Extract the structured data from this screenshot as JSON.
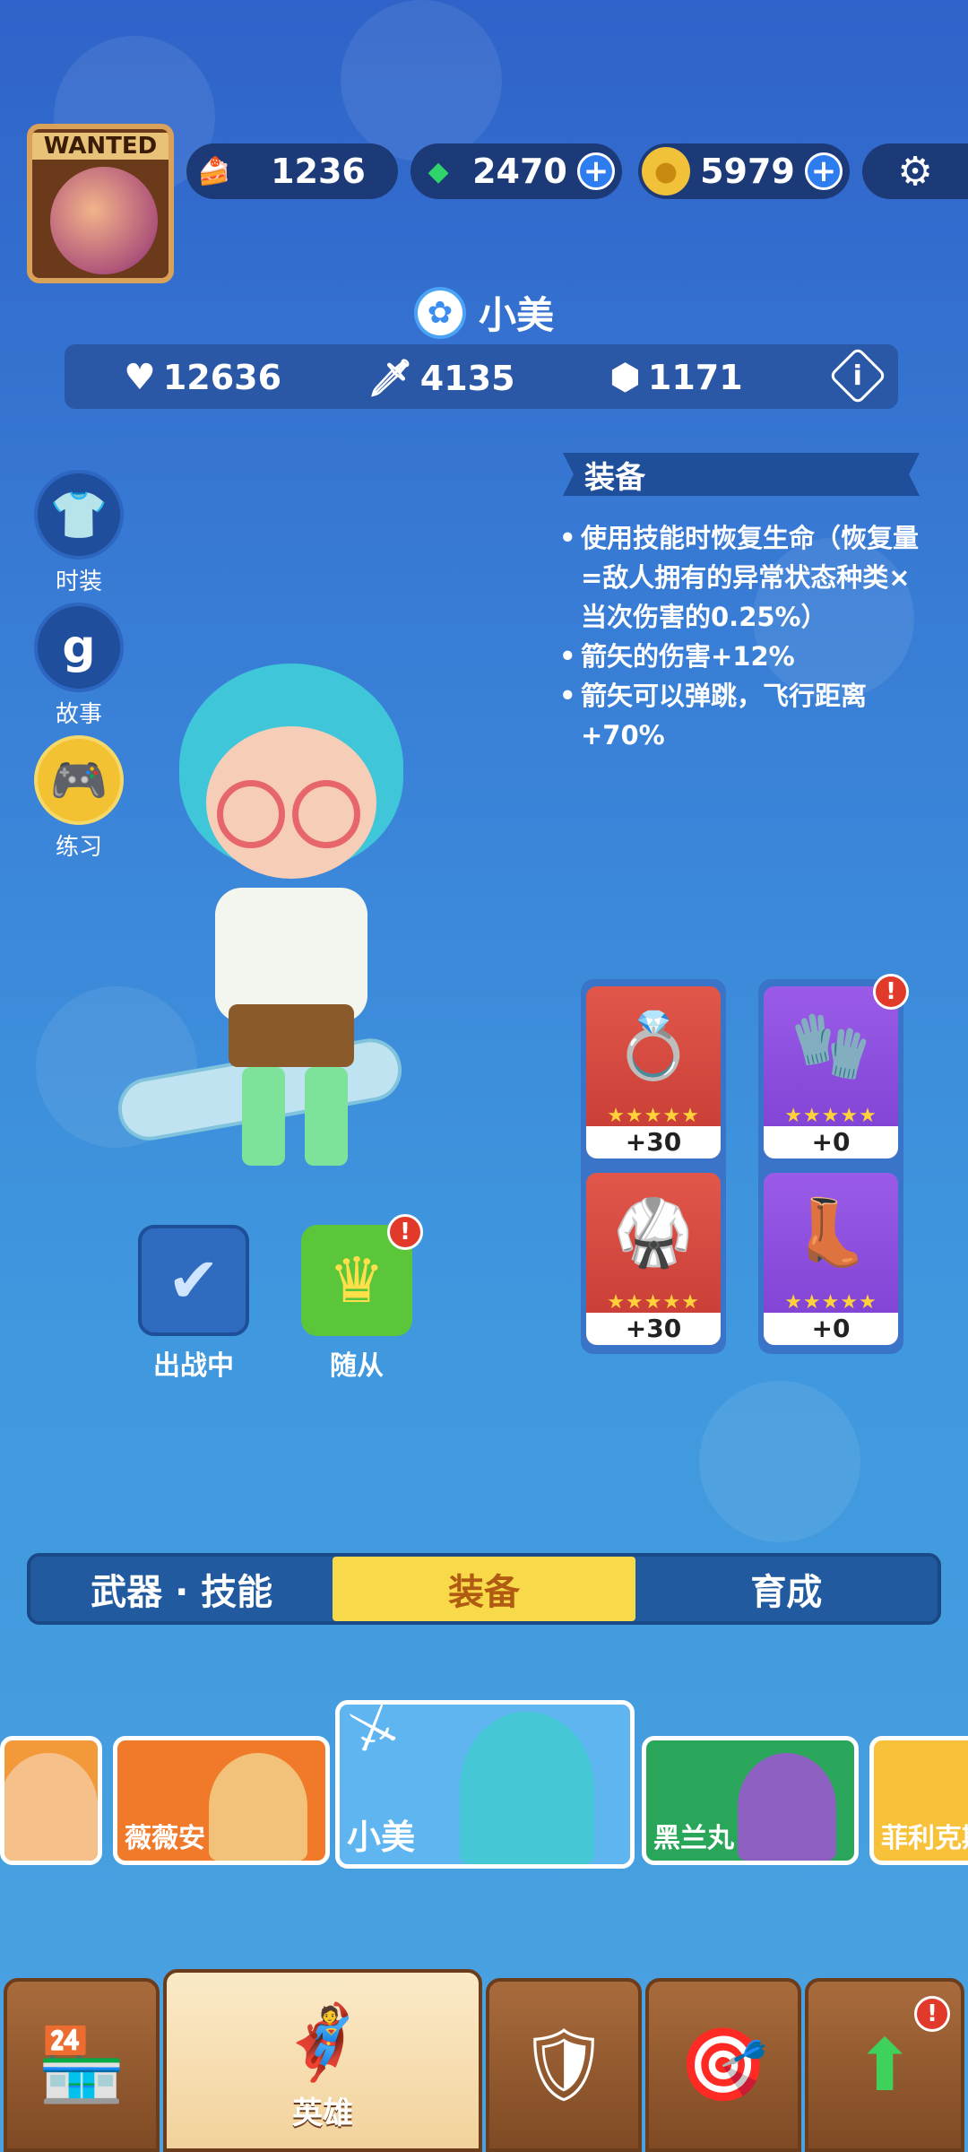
{
  "player": {
    "banner_text": "WANTED"
  },
  "resources": [
    {
      "name": "cake",
      "icon": "cake-icon",
      "value": "1236",
      "has_plus": false
    },
    {
      "name": "gem",
      "icon": "gem-icon",
      "value": "2470",
      "has_plus": true
    },
    {
      "name": "coin",
      "icon": "coin-icon",
      "value": "5979",
      "has_plus": true
    }
  ],
  "hero": {
    "name": "小美",
    "stats": {
      "hp": "12636",
      "attack": "4135",
      "defense": "1171"
    }
  },
  "side_buttons": [
    {
      "id": "outfit",
      "label": "时装",
      "icon": "shirt-icon"
    },
    {
      "id": "story",
      "label": "故事",
      "icon": "story-icon"
    },
    {
      "id": "practice",
      "label": "练习",
      "icon": "gamepad-icon"
    }
  ],
  "equipment": {
    "title": "装备",
    "effects": [
      "使用技能时恢复生命（恢复量=敌人拥有的异常状态种类×当次伤害的0.25%）",
      "箭矢的伤害+12%",
      "箭矢可以弹跳，飞行距离+70%"
    ],
    "slots": [
      {
        "id": "ring",
        "rarity": "red",
        "icon": "winged-ring-icon",
        "stars": 5,
        "level": "+30",
        "alert": false
      },
      {
        "id": "gloves",
        "rarity": "purple",
        "icon": "gloves-icon",
        "stars": 5,
        "level": "+0",
        "alert": true
      },
      {
        "id": "armor",
        "rarity": "red",
        "icon": "armor-icon",
        "stars": 5,
        "level": "+30",
        "alert": false
      },
      {
        "id": "boots",
        "rarity": "purple",
        "icon": "boots-icon",
        "stars": 5,
        "level": "+0",
        "alert": false
      }
    ]
  },
  "actions": {
    "deployed_label": "出战中",
    "follower_label": "随从"
  },
  "tabs": [
    {
      "label": "武器 · 技能",
      "active": false
    },
    {
      "label": "装备",
      "active": true
    },
    {
      "label": "育成",
      "active": false
    }
  ],
  "hero_cards": [
    {
      "name": "",
      "color": "#f29a3a"
    },
    {
      "name": "薇薇安",
      "color": "#f07a2a"
    },
    {
      "name": "小美",
      "color": "#5fb5f0",
      "selected": true
    },
    {
      "name": "黑兰丸",
      "color": "#2aa65a"
    },
    {
      "name": "菲利克斯",
      "color": "#f7c23a"
    }
  ],
  "nav": [
    {
      "id": "shop",
      "label": "",
      "icon": "shop-icon"
    },
    {
      "id": "heroes",
      "label": "英雄",
      "icon": "hero-icon",
      "active": true
    },
    {
      "id": "battle",
      "label": "",
      "icon": "battle-shield-icon"
    },
    {
      "id": "events",
      "label": "",
      "icon": "target-icon"
    },
    {
      "id": "upgrade",
      "label": "",
      "icon": "upgrade-arrow-icon",
      "alert": true
    }
  ]
}
